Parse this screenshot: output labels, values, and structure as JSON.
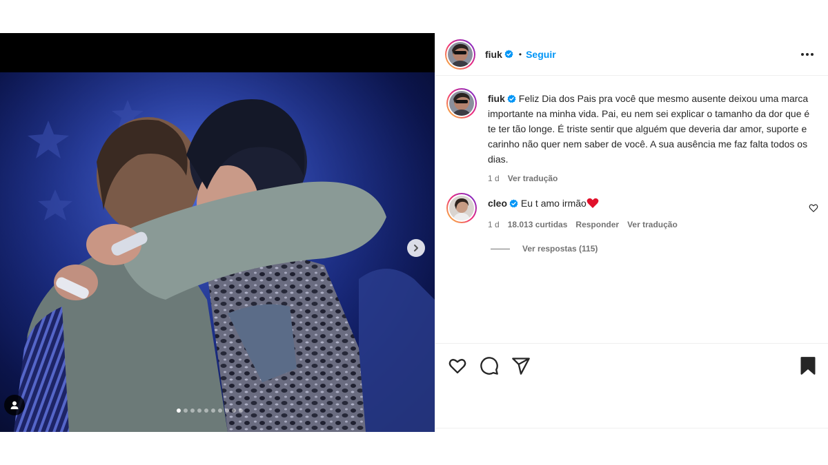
{
  "post": {
    "author": "fiuk",
    "follow_label": "Seguir",
    "separator": "•",
    "image_position": 1,
    "image_count": 10
  },
  "caption": {
    "username": "fiuk",
    "text": "Feliz Dia dos Pais pra você que mesmo ausente deixou uma marca importante na minha vida. Pai, eu nem sei explicar o tamanho da dor que é te ter tão longe. É triste sentir que alguém que deveria dar amor, suporte e carinho não quer nem saber de você. A sua ausência me faz falta todos os dias.",
    "time": "1 d",
    "translate": "Ver tradução"
  },
  "comment": {
    "username": "cleo",
    "text": "Eu t amo irmão",
    "emoji": "❤️",
    "time": "1 d",
    "likes": "18.013 curtidas",
    "reply": "Responder",
    "translate": "Ver tradução",
    "view_replies": "Ver respostas (115)"
  },
  "colors": {
    "accent": "#0095f6",
    "verified": "#0095f6",
    "muted": "#737373",
    "text": "#262626",
    "heart": "#ed4956"
  },
  "icons": [
    "verified-badge-icon",
    "more-options-icon",
    "next-arrow-icon",
    "user-tag-icon",
    "like-icon",
    "comment-icon",
    "share-icon",
    "save-icon",
    "comment-like-icon"
  ]
}
